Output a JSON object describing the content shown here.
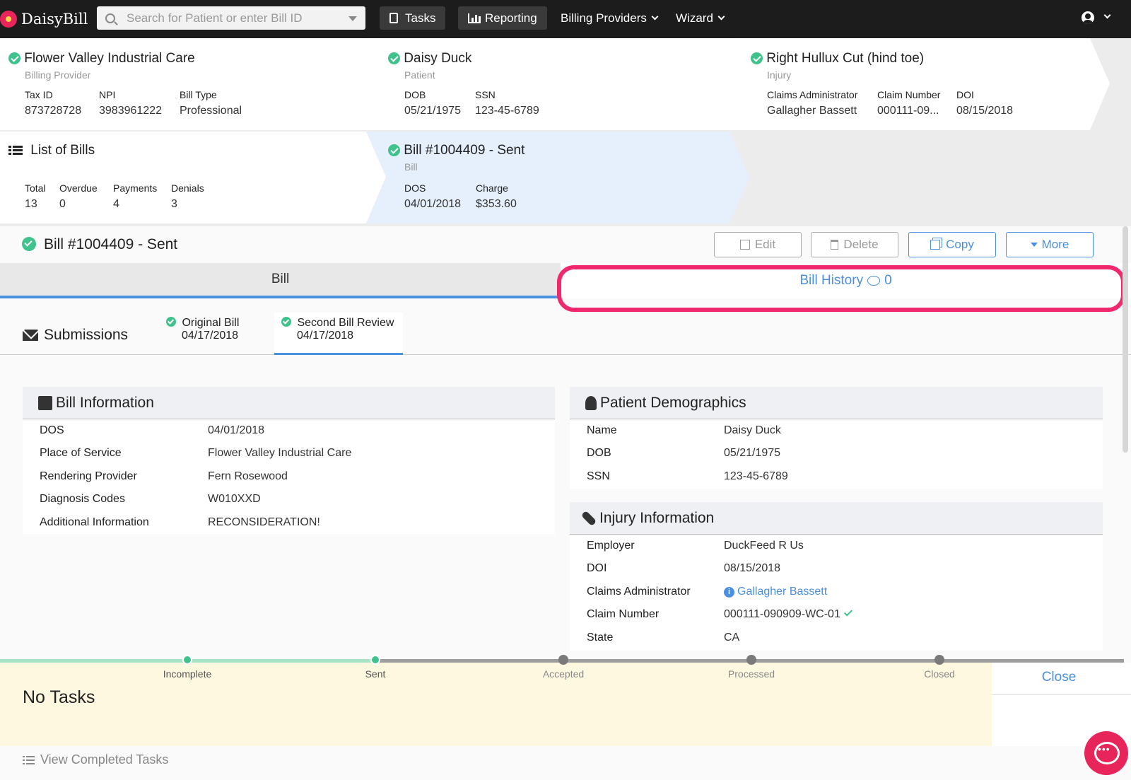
{
  "app": {
    "name": "DaisyBill"
  },
  "nav": {
    "search_placeholder": "Search for Patient or enter Bill ID",
    "tasks": "Tasks",
    "reporting": "Reporting",
    "billing_providers": "Billing Providers",
    "wizard": "Wizard"
  },
  "cards": {
    "provider": {
      "title": "Flower Valley Industrial Care",
      "subtitle": "Billing Provider",
      "fields": [
        {
          "label": "Tax ID",
          "value": "873728728"
        },
        {
          "label": "NPI",
          "value": "3983961222"
        },
        {
          "label": "Bill Type",
          "value": "Professional"
        }
      ]
    },
    "patient": {
      "title": "Daisy Duck",
      "subtitle": "Patient",
      "fields": [
        {
          "label": "DOB",
          "value": "05/21/1975"
        },
        {
          "label": "SSN",
          "value": "123-45-6789"
        }
      ]
    },
    "injury": {
      "title": "Right Hullux Cut (hind toe)",
      "subtitle": "Injury",
      "fields": [
        {
          "label": "Claims Administrator",
          "value": "Gallagher Bassett"
        },
        {
          "label": "Claim Number",
          "value": "000111-09..."
        },
        {
          "label": "DOI",
          "value": "08/15/2018"
        }
      ]
    },
    "bills": {
      "title": "List of Bills",
      "fields": [
        {
          "label": "Total",
          "value": "13"
        },
        {
          "label": "Overdue",
          "value": "0"
        },
        {
          "label": "Payments",
          "value": "4"
        },
        {
          "label": "Denials",
          "value": "3"
        }
      ]
    },
    "bill": {
      "title": "Bill #1004409 - Sent",
      "subtitle": "Bill",
      "fields": [
        {
          "label": "DOS",
          "value": "04/01/2018"
        },
        {
          "label": "Charge",
          "value": "$353.60"
        }
      ]
    }
  },
  "bill_header": {
    "title": "Bill #1004409 - Sent",
    "edit": "Edit",
    "delete": "Delete",
    "copy": "Copy",
    "more": "More"
  },
  "tabs": {
    "bill": "Bill",
    "history": "Bill History",
    "history_count": "0"
  },
  "submissions": {
    "title": "Submissions",
    "items": [
      {
        "label": "Original Bill",
        "date": "04/17/2018"
      },
      {
        "label": "Second Bill Review",
        "date": "04/17/2018"
      }
    ]
  },
  "bill_info": {
    "title": "Bill Information",
    "rows": [
      {
        "label": "DOS",
        "value": "04/01/2018"
      },
      {
        "label": "Place of Service",
        "value": "Flower Valley Industrial Care"
      },
      {
        "label": "Rendering Provider",
        "value": "Fern Rosewood"
      },
      {
        "label": "Diagnosis Codes",
        "value": "W010XXD"
      },
      {
        "label": "Additional Information",
        "value": "RECONSIDERATION!"
      }
    ]
  },
  "demographics": {
    "title": "Patient Demographics",
    "rows": [
      {
        "label": "Name",
        "value": "Daisy Duck"
      },
      {
        "label": "DOB",
        "value": "05/21/1975"
      },
      {
        "label": "SSN",
        "value": "123-45-6789"
      }
    ]
  },
  "injury_info": {
    "title": "Injury Information",
    "rows": [
      {
        "label": "Employer",
        "value": "DuckFeed R Us"
      },
      {
        "label": "DOI",
        "value": "08/15/2018"
      },
      {
        "label": "Claims Administrator",
        "value": "Gallagher Bassett"
      },
      {
        "label": "Claim Number",
        "value": "000111-090909-WC-01"
      },
      {
        "label": "State",
        "value": "CA"
      }
    ]
  },
  "progress": {
    "steps": [
      "Incomplete",
      "Sent",
      "Accepted",
      "Processed",
      "Closed"
    ],
    "completed_count": 2
  },
  "tasks": {
    "title": "No Tasks",
    "close": "Close",
    "view_completed": "View Completed Tasks"
  },
  "colors": {
    "accent": "#4a8fe0",
    "success": "#3fc28c",
    "highlight": "#f0286e",
    "brand": "#e8255a"
  }
}
